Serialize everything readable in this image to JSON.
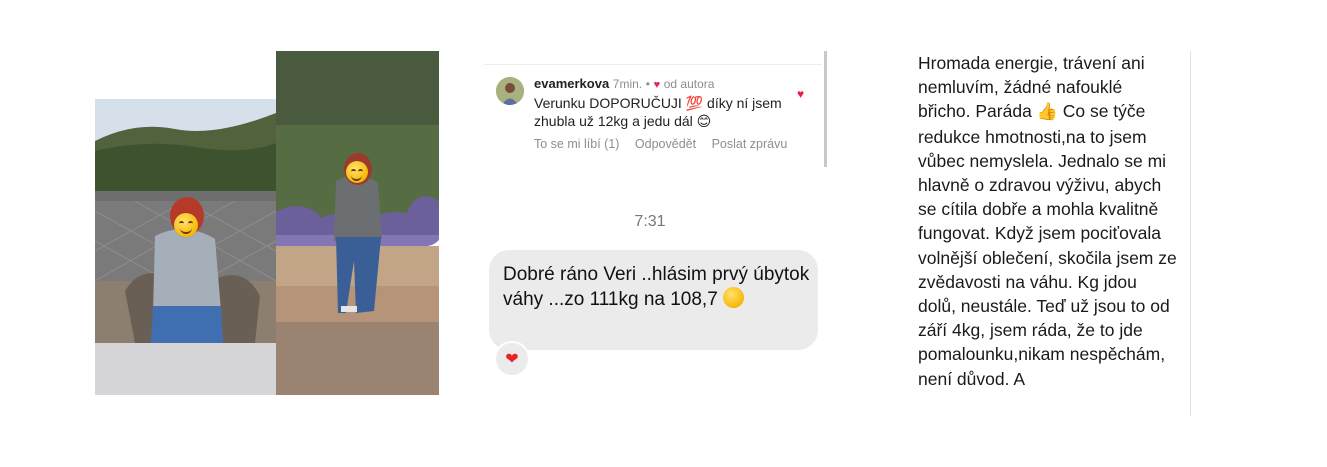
{
  "instagram_comment": {
    "username": "evamerkova",
    "time": "7min.",
    "separator": "•",
    "author_badge": "od autora",
    "text": "Verunku DOPORUČUJI 💯 díky ní jsem zhubla už 12kg a jedu dál 😊",
    "actions": [
      "To se mi líbí (1)",
      "Odpovědět",
      "Poslat zprávu"
    ],
    "liked_heart": "♥"
  },
  "message": {
    "timestamp": "7:31",
    "text": "Dobré ráno Veri ..hlásim prvý úbytok váhy ...zo 111kg na 108,7",
    "reaction": "❤"
  },
  "note": {
    "text_part1": "Hromada energie, trávení ani nemluvím, žádné nafouklé břicho. Paráda ",
    "thumb": "👍",
    "text_part2": " Co se týče redukce hmotnosti,na to jsem vůbec nemyslela. Jednalo se mi hlavně o zdravou výživu, abych se cítila dobře a mohla kvalitně fungovat. Když jsem pociťovala volnější oblečení, skočila jsem ze zvědavosti na váhu. Kg jdou dolů, neustále. Teď už jsou to od září 4kg, jsem ráda, že to jde pomalounku,nikam nespěchám, není důvod. A"
  },
  "colors": {
    "bubble": "#ebebeb",
    "heart": "#e0245e",
    "muted": "#8e8e8e"
  }
}
